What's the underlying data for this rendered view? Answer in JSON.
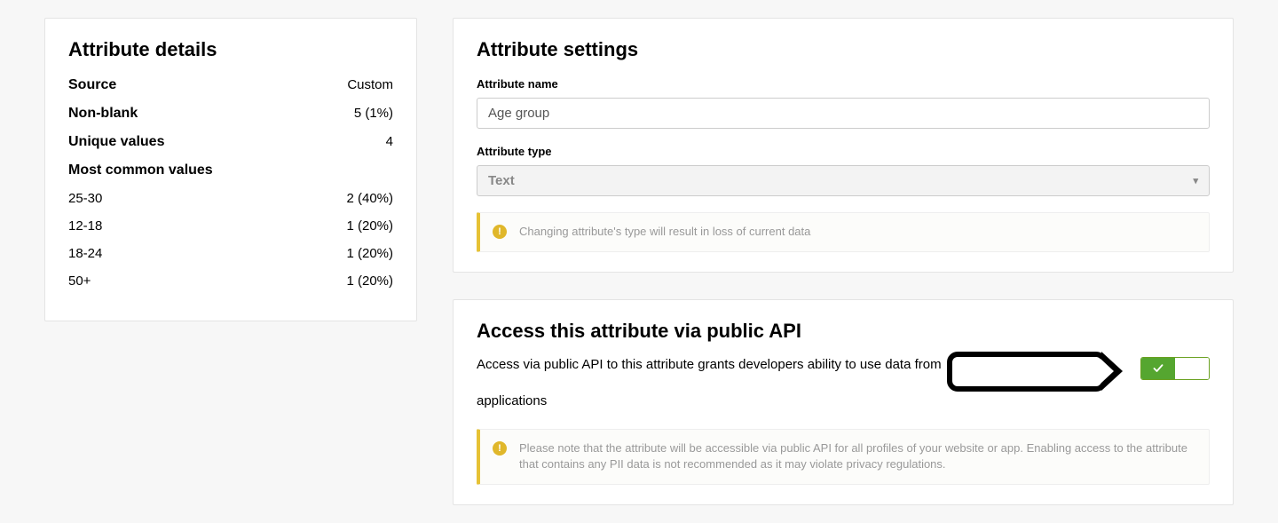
{
  "details": {
    "heading": "Attribute details",
    "source_label": "Source",
    "source_value": "Custom",
    "nonblank_label": "Non-blank",
    "nonblank_value": "5 (1%)",
    "unique_label": "Unique values",
    "unique_value": "4",
    "common_heading": "Most common values",
    "common": [
      {
        "label": "25-30",
        "value": "2 (40%)"
      },
      {
        "label": "12-18",
        "value": "1 (20%)"
      },
      {
        "label": "18-24",
        "value": "1 (20%)"
      },
      {
        "label": "50+",
        "value": "1 (20%)"
      }
    ]
  },
  "settings": {
    "heading": "Attribute settings",
    "name_label": "Attribute name",
    "name_value": "Age group",
    "type_label": "Attribute type",
    "type_value": "Text",
    "type_warning": "Changing attribute's type will result in loss of current data"
  },
  "api": {
    "heading": "Access this attribute via public API",
    "desc_prefix": "Access via public API to this attribute grants developers ability to use data from",
    "desc_suffix": "applications",
    "toggle_state": "on",
    "note": "Please note that the attribute will be accessible via public API for all profiles of your website or app. Enabling access to the attribute that contains any PII data is not recommended as it may violate privacy regulations."
  }
}
